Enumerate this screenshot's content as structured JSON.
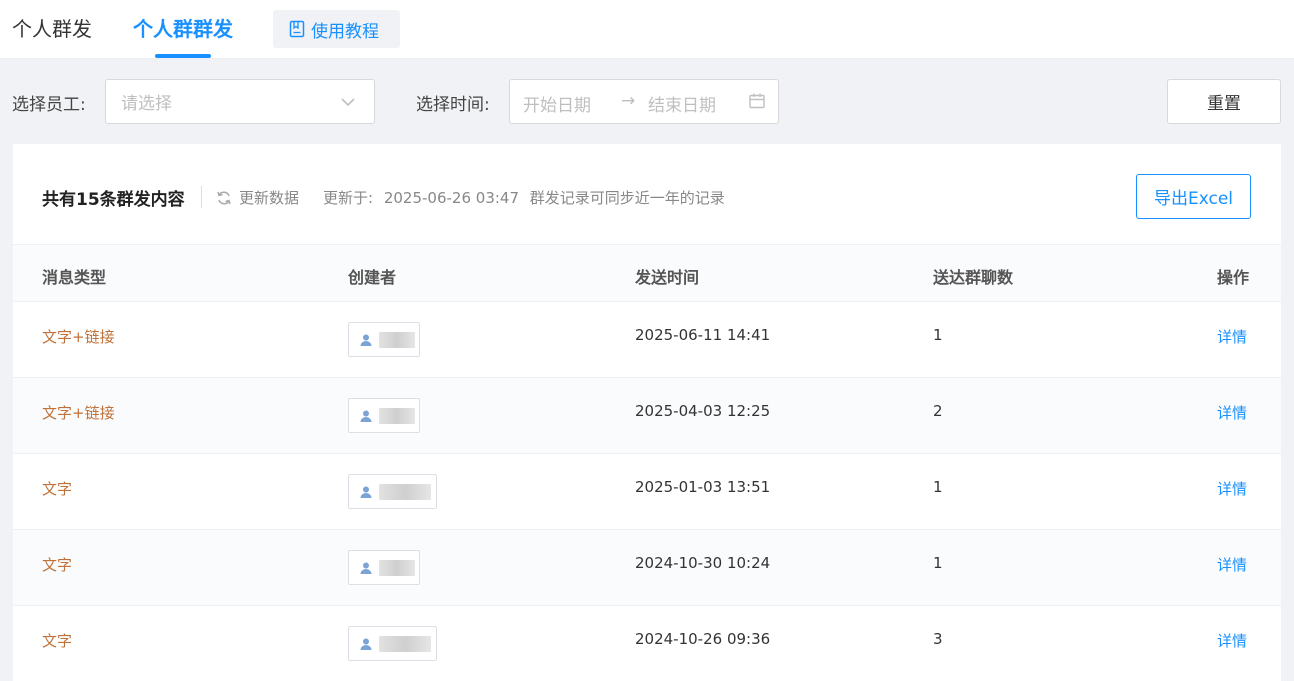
{
  "tabs": [
    {
      "label": "个人群发",
      "active": false
    },
    {
      "label": "个人群群发",
      "active": true
    }
  ],
  "tutorial": {
    "label": "使用教程",
    "icon": "book-icon"
  },
  "filters": {
    "employee_label": "选择员工:",
    "employee_placeholder": "请选择",
    "time_label": "选择时间:",
    "start_placeholder": "开始日期",
    "range_arrow": "→",
    "end_placeholder": "结束日期",
    "reset_label": "重置"
  },
  "summary": {
    "total_text": "共有15条群发内容",
    "refresh_label": "更新数据",
    "updated_prefix": "更新于:",
    "updated_time": "2025-06-26 03:47",
    "note": "群发记录可同步近一年的记录",
    "export_label": "导出Excel"
  },
  "table": {
    "headers": [
      "消息类型",
      "创建者",
      "发送时间",
      "送达群聊数",
      "操作"
    ],
    "rows": [
      {
        "type": "文字+链接",
        "time": "2025-06-11 14:41",
        "count": "1",
        "op": "详情"
      },
      {
        "type": "文字+链接",
        "time": "2025-04-03 12:25",
        "count": "2",
        "op": "详情"
      },
      {
        "type": "文字",
        "time": "2025-01-03 13:51",
        "count": "1",
        "op": "详情"
      },
      {
        "type": "文字",
        "time": "2024-10-30 10:24",
        "count": "1",
        "op": "详情"
      },
      {
        "type": "文字",
        "time": "2024-10-26 09:36",
        "count": "3",
        "op": "详情"
      }
    ]
  },
  "colors": {
    "accent": "#1890ff",
    "type_text": "#c0723a"
  }
}
